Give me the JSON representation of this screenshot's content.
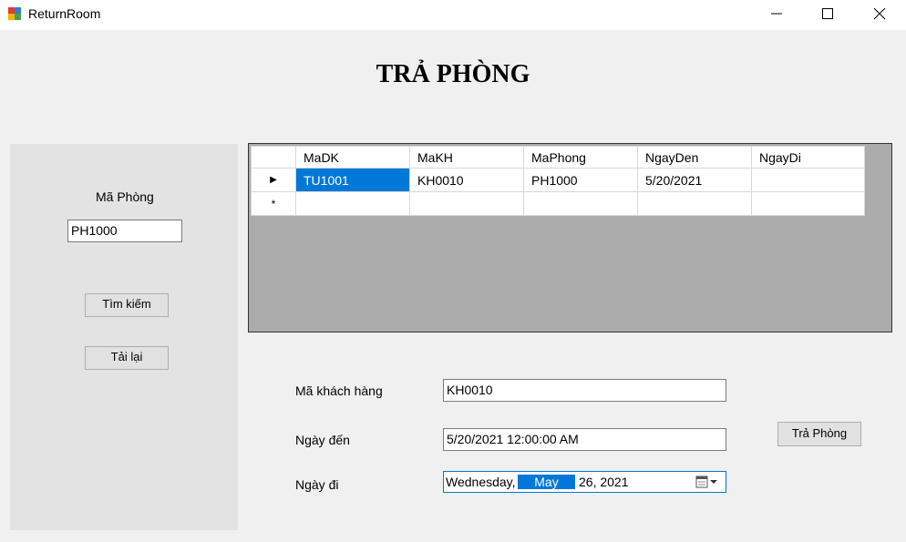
{
  "window": {
    "title": "ReturnRoom",
    "controls": [
      "minimize-icon",
      "maximize-icon",
      "close-icon"
    ]
  },
  "heading": "TRẢ PHÒNG",
  "left_panel": {
    "room_label": "Mã Phòng",
    "room_value": "PH1000",
    "search_button": "Tìm kiếm",
    "reload_button": "Tải lại"
  },
  "grid": {
    "columns": [
      "MaDK",
      "MaKH",
      "MaPhong",
      "NgayDen",
      "NgayDi"
    ],
    "rows": [
      [
        "TU1001",
        "KH0010",
        "PH1000",
        "5/20/2021",
        ""
      ]
    ],
    "row_markers": [
      "▶",
      "*"
    ]
  },
  "form": {
    "customer_label": "Mã khách hàng",
    "customer_value": "KH0010",
    "arrival_label": "Ngày đến",
    "arrival_value": "5/20/2021 12:00:00 AM",
    "departure_label": "Ngày đi",
    "departure_weekday": "Wednesday,",
    "departure_month": "May",
    "departure_rest": "26, 2021",
    "checkout_button": "Trả Phòng"
  },
  "colors": {
    "selection": "#0078d7",
    "grid_background": "#ababab",
    "panel": "#e3e3e3"
  }
}
